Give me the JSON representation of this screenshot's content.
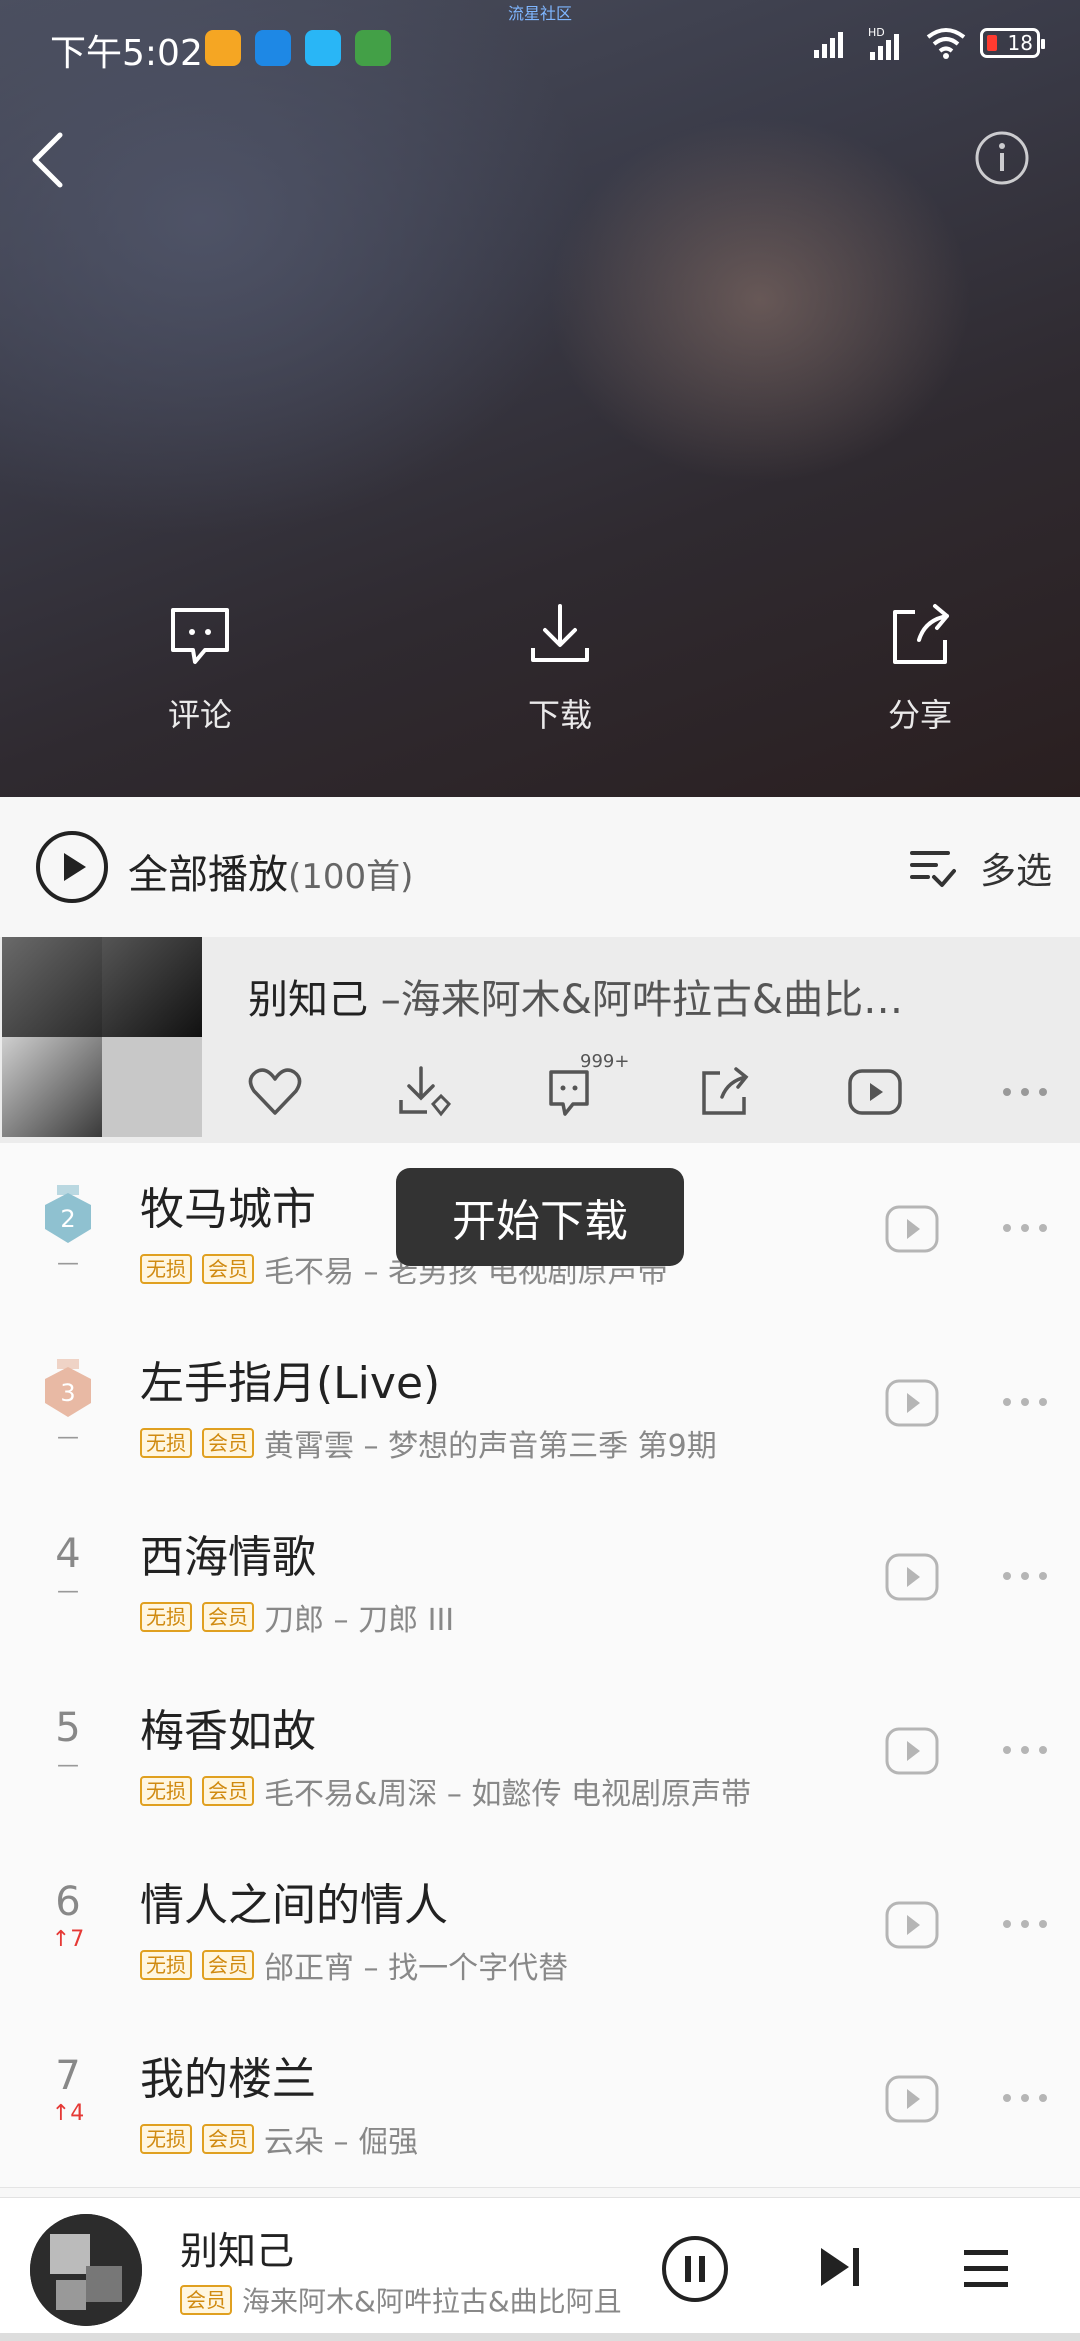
{
  "status": {
    "time": "下午5:02",
    "battery": "18",
    "network": "HD",
    "community_label": "流星社区"
  },
  "actions": [
    {
      "label": "评论",
      "icon": "comment-icon"
    },
    {
      "label": "下载",
      "icon": "download-icon"
    },
    {
      "label": "分享",
      "icon": "share-icon"
    }
  ],
  "playall": {
    "label": "全部播放",
    "count": "(100首)",
    "multiselect": "多选"
  },
  "current": {
    "title": "别知己",
    "artist": " –海来阿木&阿吽拉古&曲比…",
    "comment_badge": "999+"
  },
  "toast": "开始下载",
  "songs": [
    {
      "rank": "2",
      "change": "—",
      "title": "牧马城市",
      "sub": "毛不易 – 老男孩 电视剧原声带"
    },
    {
      "rank": "3",
      "change": "—",
      "title": "左手指月(Live)",
      "sub": "黄霄雲 – 梦想的声音第三季 第9期"
    },
    {
      "rank": "4",
      "change": "—",
      "title": "西海情歌",
      "sub": "刀郎 – 刀郎 III"
    },
    {
      "rank": "5",
      "change": "—",
      "title": "梅香如故",
      "sub": "毛不易&周深 – 如懿传 电视剧原声带"
    },
    {
      "rank": "6",
      "change": "↑7",
      "title": "情人之间的情人",
      "sub": "邰正宵 – 找一个字代替"
    },
    {
      "rank": "7",
      "change": "↑4",
      "title": "我的楼兰",
      "sub": "云朵 – 倔强"
    }
  ],
  "tags": {
    "lossless": "无损",
    "vip": "会员"
  },
  "player": {
    "title": "别知己",
    "artist": "海来阿木&阿吽拉古&曲比阿且"
  },
  "colors": {
    "accent_tag": "#e0a020",
    "up_arrow": "#e53935"
  }
}
